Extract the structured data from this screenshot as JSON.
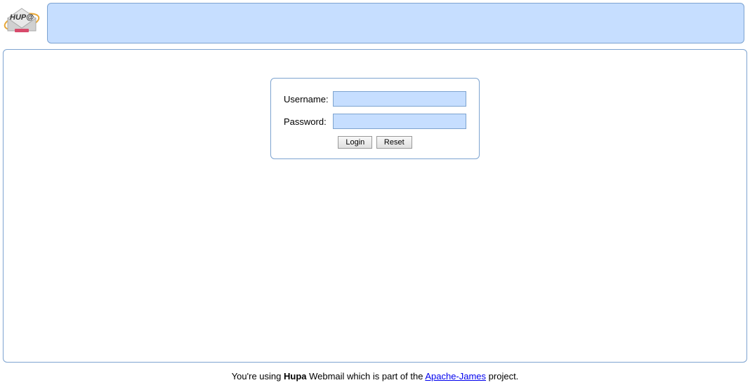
{
  "app": {
    "name": "Hupa"
  },
  "login": {
    "username_label": "Username:",
    "password_label": "Password:",
    "username_value": "",
    "password_value": "",
    "login_button": "Login",
    "reset_button": "Reset"
  },
  "footer": {
    "prefix": "You're using ",
    "app_bold": "Hupa",
    "middle": " Webmail which is part of the ",
    "link_text": "Apache-James",
    "suffix": " project."
  }
}
